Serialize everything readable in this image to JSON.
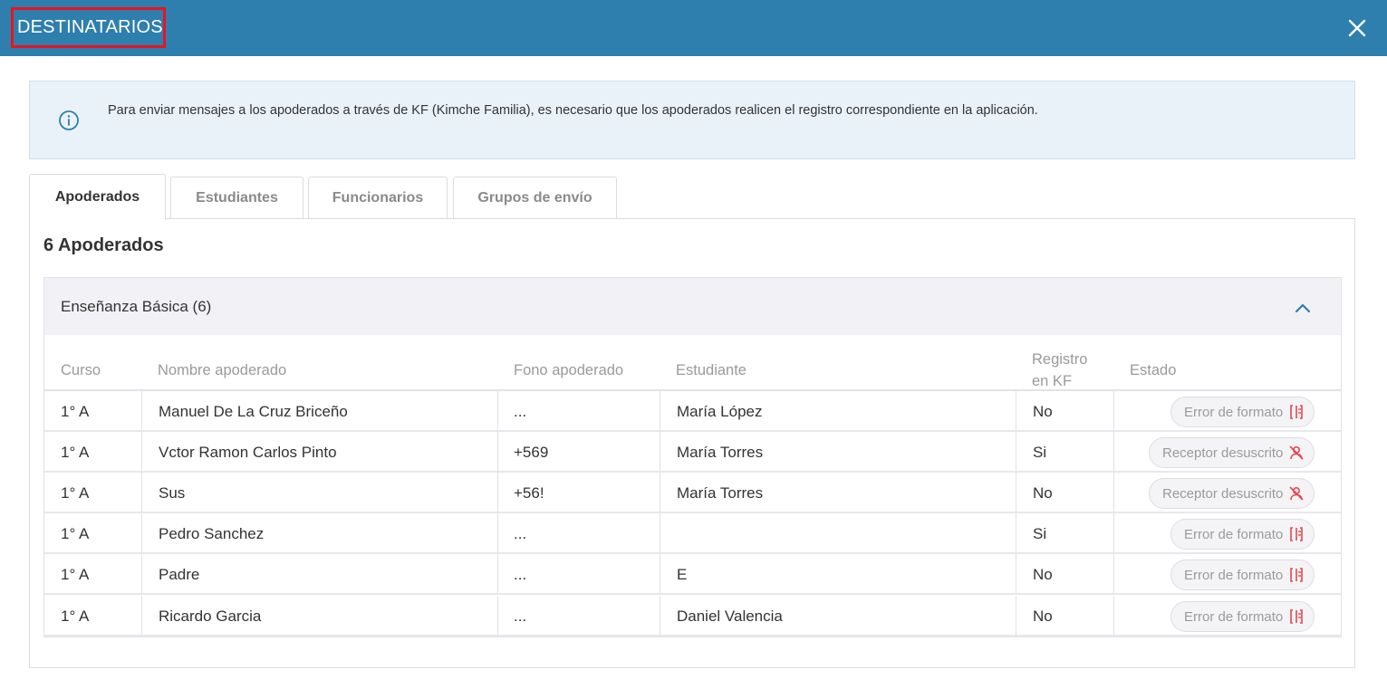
{
  "header": {
    "title": "DESTINATARIOS"
  },
  "info": {
    "text": "Para enviar mensajes a los apoderados a través de KF (Kimche Familia), es necesario que los apoderados realicen el registro correspondiente en la aplicación."
  },
  "tabs": [
    {
      "label": "Apoderados",
      "active": true
    },
    {
      "label": "Estudiantes",
      "active": false
    },
    {
      "label": "Funcionarios",
      "active": false
    },
    {
      "label": "Grupos de envío",
      "active": false
    }
  ],
  "panel": {
    "count_title": "6 Apoderados"
  },
  "accordion": {
    "title": "Enseñanza Básica (6)"
  },
  "table": {
    "headers": {
      "curso": "Curso",
      "nombre": "Nombre apoderado",
      "fono": "Fono apoderado",
      "estudiante": "Estudiante",
      "registro_1": "Registro",
      "registro_2": "en KF",
      "estado": "Estado"
    },
    "rows": [
      {
        "curso": "1° A",
        "nombre": "Manuel De La Cruz Briceño",
        "fono": "...",
        "estudiante": "María López",
        "registro": "No",
        "estado": "Error de formato",
        "estado_icon": "format-error-icon"
      },
      {
        "curso": "1° A",
        "nombre": "Vctor Ramon Carlos Pinto",
        "fono": "+569",
        "estudiante": "María Torres",
        "registro": "Si",
        "estado": "Receptor desuscrito",
        "estado_icon": "user-unsubscribed-icon"
      },
      {
        "curso": "1° A",
        "nombre": "Sus",
        "fono": "+56!",
        "estudiante": "María Torres",
        "registro": "No",
        "estado": "Receptor desuscrito",
        "estado_icon": "user-unsubscribed-icon"
      },
      {
        "curso": "1° A",
        "nombre": "Pedro Sanchez",
        "fono": "...",
        "estudiante": "",
        "registro": "Si",
        "estado": "Error de formato",
        "estado_icon": "format-error-icon"
      },
      {
        "curso": "1° A",
        "nombre": "Padre",
        "fono": "...",
        "estudiante": "E",
        "registro": "No",
        "estado": "Error de formato",
        "estado_icon": "format-error-icon"
      },
      {
        "curso": "1° A",
        "nombre": "Ricardo Garcia",
        "fono": "...",
        "estudiante": "Daniel Valencia",
        "registro": "No",
        "estado": "Error de formato",
        "estado_icon": "format-error-icon"
      }
    ]
  },
  "colors": {
    "header_bg": "#2e7fae",
    "highlight_border": "#e8141e",
    "error_icon": "#e8454d",
    "info_bg": "#eaf2f9"
  }
}
